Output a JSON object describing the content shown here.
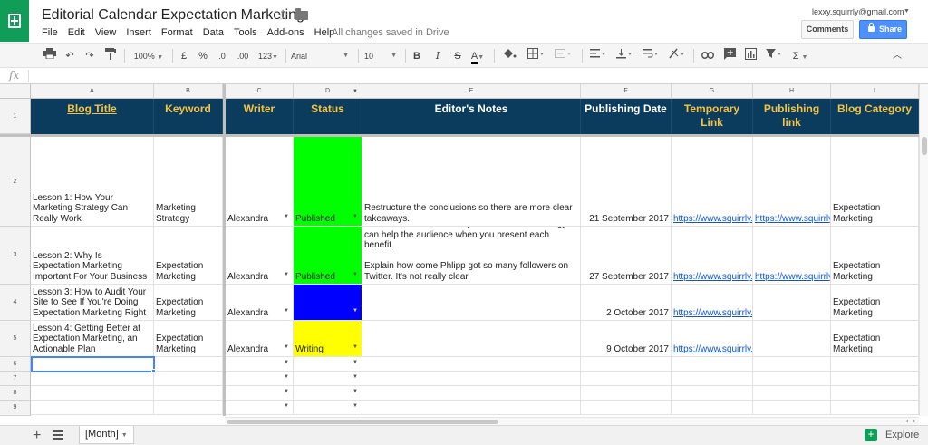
{
  "header": {
    "title": "Editorial Calendar Expectation Marketing",
    "menu": [
      "File",
      "Edit",
      "View",
      "Insert",
      "Format",
      "Data",
      "Tools",
      "Add-ons",
      "Help"
    ],
    "save_status": "All changes saved in Drive",
    "user_email": "lexxy.squirrly@gmail.com",
    "comments_label": "Comments",
    "share_label": "Share"
  },
  "toolbar": {
    "zoom": "100%",
    "currency": "£",
    "percent": "%",
    "dec_decrease": ".0",
    "dec_increase": ".00",
    "more_formats": "123",
    "font": "Arial",
    "font_size": "10",
    "bold": "B",
    "italic": "I",
    "strikethrough": "S",
    "text_color": "A",
    "sum": "Σ"
  },
  "formula_bar": {
    "fx": "fx",
    "value": ""
  },
  "grid": {
    "columns": [
      "A",
      "B",
      "C",
      "D",
      "E",
      "F",
      "G",
      "H",
      "I"
    ],
    "row_numbers": [
      "1",
      "2",
      "3",
      "4",
      "5",
      "6",
      "7",
      "8",
      "9"
    ],
    "headers": [
      "Blog Title",
      "Keyword",
      "Writer",
      "Status",
      "Editor's Notes",
      "Publishing Date",
      "Temporary Link",
      "Publishing link",
      "Blog Category"
    ],
    "rows": [
      {
        "title": "Lesson 1: How Your Marketing Strategy Can Really Work",
        "keyword": "Marketing Strategy",
        "writer": "Alexandra",
        "status": "Published",
        "status_color": "#00ff00",
        "notes": "Restructure the conclusions so there are more clear takeaways.",
        "date": "21 September 2017",
        "temp_link": "https://www.squirrly.c",
        "pub_link": "https://www.squirrly",
        "category": "Expectation Marketing"
      },
      {
        "title": "Lesson 2: Why Is Expectation Marketing Important For Your Business",
        "keyword": "Expectation Marketing",
        "writer": "Alexandra",
        "status": "Published",
        "status_color": "#00ff00",
        "notes": "Add some concrete examples on how this strategy can help the audience when you present each benefit.\n\nExplain how come Phlipp got so many followers on Twitter. It's not really clear.",
        "date": "27 September 2017",
        "temp_link": "https://www.squirrly.c",
        "pub_link": "https://www.squirrly",
        "category": "Expectation Marketing"
      },
      {
        "title": "Lesson 3: How to Audit Your Site to See If You're Doing Expectation Marketing Right",
        "keyword": "Expectation Marketing",
        "writer": "Alexandra",
        "status": "",
        "status_color": "#0000ff",
        "notes": "",
        "date": "2 October 2017",
        "temp_link": "https://www.squirrly.c",
        "pub_link": "",
        "category": "Expectation Marketing"
      },
      {
        "title": "Lesson 4: Getting Better at Expectation Marketing, an Actionable Plan",
        "keyword": "Expectation Marketing",
        "writer": "Alexandra",
        "status": "Writing",
        "status_color": "#ffff00",
        "notes": "",
        "date": "9 October 2017",
        "temp_link": "https://www.squirrly.c",
        "pub_link": "",
        "category": "Expectation Marketing"
      }
    ],
    "header_bg": "#0b3c5d",
    "header_gold": "#f6c443"
  },
  "sheet_tabs": {
    "active": "[Month]"
  },
  "explore_label": "Explore"
}
